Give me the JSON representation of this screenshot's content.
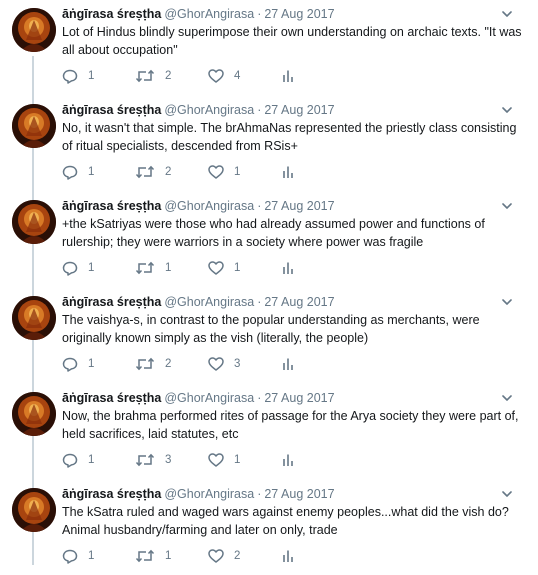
{
  "user": {
    "display_name": "āṅgīrasa śreṣṭha",
    "handle": "@GhorAngirasa",
    "separator": "·"
  },
  "icons": {
    "reply": "reply-icon",
    "retweet": "retweet-icon",
    "like": "heart-icon",
    "dm": "analytics-icon",
    "menu": "chevron-down-icon"
  },
  "colors": {
    "icon": "#657786",
    "thread_line": "#ccd6dd",
    "text": "#14171a"
  },
  "tweets": [
    {
      "date": "27 Aug 2017",
      "text": "Lot of Hindus blindly superimpose their own understanding on archaic texts. \"It was all about occupation\"",
      "replies": "1",
      "retweets": "2",
      "likes": "4"
    },
    {
      "date": "27 Aug 2017",
      "text": "No, it wasn't that simple. The brAhmaNas represented the priestly class consisting of ritual specialists, descended from RSis+",
      "replies": "1",
      "retweets": "2",
      "likes": "1"
    },
    {
      "date": "27 Aug 2017",
      "text": "+the kSatriyas were those who had already assumed power and functions of rulership; they were warriors in a society where power was fragile",
      "replies": "1",
      "retweets": "1",
      "likes": "1"
    },
    {
      "date": "27 Aug 2017",
      "text": "The vaishya-s, in contrast to the popular understanding as merchants, were originally known simply as the vish (literally, the people)",
      "replies": "1",
      "retweets": "2",
      "likes": "3"
    },
    {
      "date": "27 Aug 2017",
      "text": "Now, the brahma performed rites of passage for the Arya society they were part of, held sacrifices, laid statutes, etc",
      "replies": "1",
      "retweets": "3",
      "likes": "1"
    },
    {
      "date": "27 Aug 2017",
      "text": "The kSatra ruled and waged wars against enemy peoples...what did the vish do? Animal husbandry/farming and later on only, trade",
      "replies": "1",
      "retweets": "1",
      "likes": "2"
    }
  ]
}
